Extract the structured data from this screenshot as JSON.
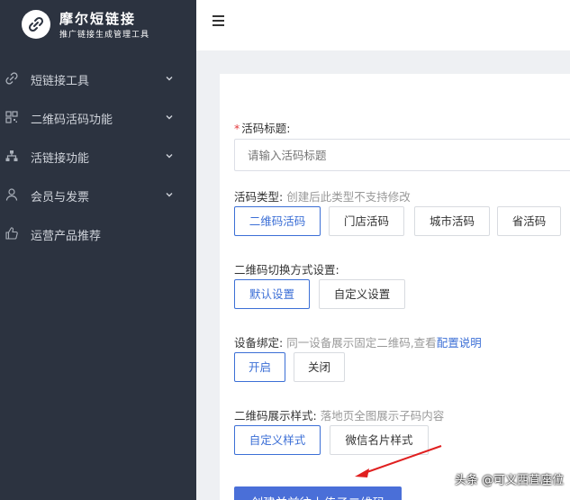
{
  "brand": {
    "name": "摩尔短链接",
    "subtitle": "推广链接生成管理工具"
  },
  "sidebar": {
    "items": [
      {
        "label": "短链接工具",
        "icon": "link-icon",
        "has_arrow": true
      },
      {
        "label": "二维码活码功能",
        "icon": "qrcode-icon",
        "has_arrow": true
      },
      {
        "label": "活链接功能",
        "icon": "sitemap-icon",
        "has_arrow": true
      },
      {
        "label": "会员与发票",
        "icon": "user-icon",
        "has_arrow": true
      },
      {
        "label": "运营产品推荐",
        "icon": "thumbs-up-icon",
        "has_arrow": false
      }
    ]
  },
  "topbar": {
    "menu_icon": "hamburger-icon"
  },
  "form": {
    "title_label": "活码标题:",
    "title_required_mark": "*",
    "title_placeholder": "请输入活码标题",
    "type_label": "活码类型:",
    "type_hint": "创建后此类型不支持修改",
    "type_options": [
      "二维码活码",
      "门店活码",
      "城市活码",
      "省活码"
    ],
    "type_selected": "二维码活码",
    "switch_label": "二维码切换方式设置:",
    "switch_options": [
      "默认设置",
      "自定义设置"
    ],
    "switch_selected": "默认设置",
    "bind_label": "设备绑定:",
    "bind_hint": "同一设备展示固定二维码,查看",
    "bind_link": "配置说明",
    "bind_options": [
      "开启",
      "关闭"
    ],
    "bind_selected": "开启",
    "style_label": "二维码展示样式:",
    "style_hint": "落地页全图展示子码内容",
    "style_options": [
      "自定义样式",
      "微信名片样式"
    ],
    "style_selected": "自定义样式",
    "submit_label": "创建并前往上传子二维码"
  },
  "watermark": "头条 @可义西苴座位",
  "colors": {
    "sidebar_bg": "#2c3340",
    "accent": "#3c6fd6",
    "primary_btn": "#4a6fd8",
    "annotation": "#e02020"
  }
}
